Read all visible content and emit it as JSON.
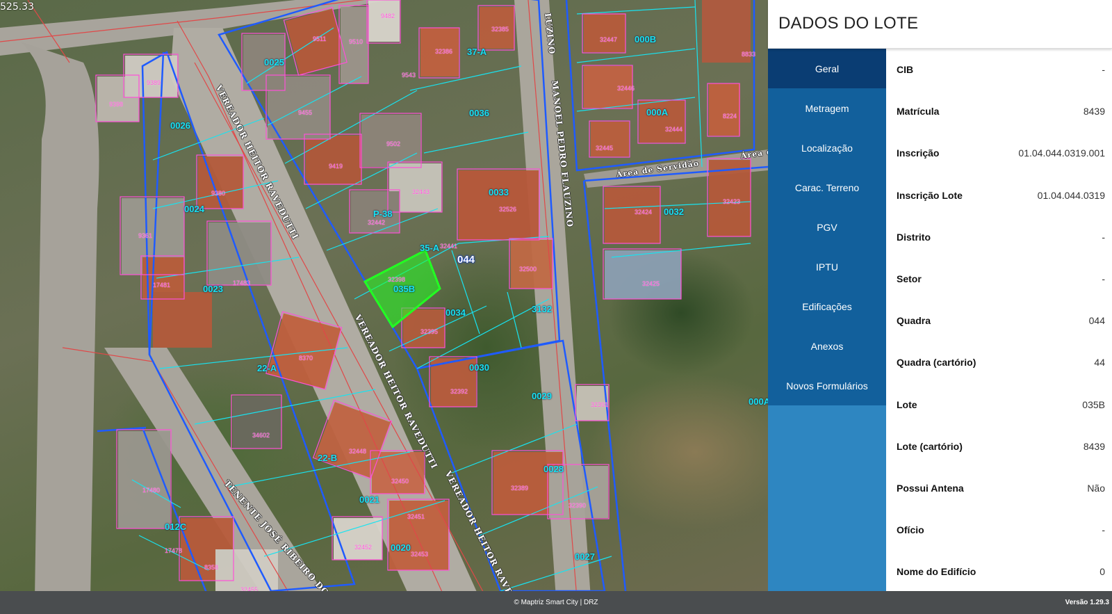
{
  "map": {
    "coord_readout": "525.33",
    "streets": [
      {
        "name": "VEREADOR HEITOR RAVEDUTTI",
        "key": "street-1"
      },
      {
        "name": "VEREADOR HEITOR RAVEDUTTI",
        "key": "street-2"
      },
      {
        "name": "VEREADOR HEITOR RAVEDUTTI",
        "key": "street-3"
      },
      {
        "name": "MANOEL PEDRO FLAUZINO",
        "key": "street-4"
      },
      {
        "name": "LUZINO",
        "key": "street-5"
      },
      {
        "name": "TENENTE JOSÉ RIBEIRO DO COUTO",
        "key": "street-6"
      },
      {
        "name": "Área de Servidão",
        "key": "street-7"
      },
      {
        "name": "Área de",
        "key": "street-8"
      }
    ],
    "quadra_label": "044",
    "lot_labels": [
      "0025",
      "0026",
      "0024",
      "0023",
      "22-A",
      "22-B",
      "0021",
      "0020",
      "012C",
      "0036",
      "37-A",
      "P-38",
      "35-A",
      "035B",
      "0034",
      "0030",
      "0029",
      "0028",
      "0027",
      "0033",
      "3132",
      "000B",
      "000A",
      "0032",
      "000A"
    ],
    "building_labels": [
      "9482",
      "32385",
      "9511",
      "9510",
      "32386",
      "9543",
      "9389",
      "9398",
      "9455",
      "32447",
      "8833",
      "32446",
      "8224",
      "32444",
      "32445",
      "9502",
      "9419",
      "9380",
      "32443",
      "32526",
      "32442",
      "32441",
      "32424",
      "32423",
      "9361",
      "17483",
      "17481",
      "32398",
      "32500",
      "32425",
      "32395",
      "8370",
      "32392",
      "32391",
      "34602",
      "32448",
      "32450",
      "32451",
      "32452",
      "32453",
      "17480",
      "17478",
      "8358",
      "32455",
      "32389",
      "32390"
    ]
  },
  "panel": {
    "title": "DADOS DO LOTE",
    "nav": [
      {
        "label": "Geral",
        "active": true
      },
      {
        "label": "Metragem",
        "active": false
      },
      {
        "label": "Localização",
        "active": false
      },
      {
        "label": "Carac. Terreno",
        "active": false
      },
      {
        "label": "PGV",
        "active": false
      },
      {
        "label": "IPTU",
        "active": false
      },
      {
        "label": "Edificações",
        "active": false
      },
      {
        "label": "Anexos",
        "active": false
      },
      {
        "label": "Novos Formulários",
        "active": false
      }
    ],
    "fields": [
      {
        "label": "CIB",
        "value": "-"
      },
      {
        "label": "Matrícula",
        "value": "8439"
      },
      {
        "label": "Inscrição",
        "value": "01.04.044.0319.001"
      },
      {
        "label": "Inscrição Lote",
        "value": "01.04.044.0319"
      },
      {
        "label": "Distrito",
        "value": "-"
      },
      {
        "label": "Setor",
        "value": "-"
      },
      {
        "label": "Quadra",
        "value": "044"
      },
      {
        "label": "Quadra (cartório)",
        "value": "44"
      },
      {
        "label": "Lote",
        "value": "035B"
      },
      {
        "label": "Lote (cartório)",
        "value": "8439"
      },
      {
        "label": "Possui Antena",
        "value": "Não"
      },
      {
        "label": "Ofício",
        "value": "-"
      },
      {
        "label": "Nome do Edifício",
        "value": "0"
      }
    ]
  },
  "footer": {
    "credit": "© Maptriz Smart City | DRZ",
    "version": "Versão 1.29.3"
  },
  "colors": {
    "nav_bg": "#12609c",
    "nav_active": "#0a3d73",
    "nav_fill": "#2e86c1",
    "lot_line": "#18e3f0",
    "block_line": "#1f5bff",
    "building_line": "#ff4fd8",
    "selected_lot": "#22ff22"
  }
}
